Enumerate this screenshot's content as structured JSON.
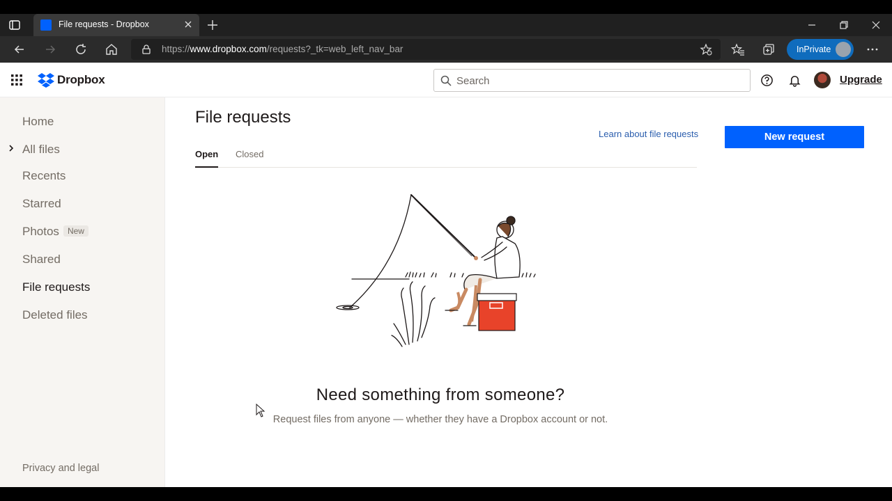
{
  "browser": {
    "tab_title": "File requests - Dropbox",
    "url_prefix": "https://",
    "url_host": "www.dropbox.com",
    "url_path": "/requests?_tk=web_left_nav_bar",
    "inprivate_label": "InPrivate"
  },
  "header": {
    "logo_text": "Dropbox",
    "search_placeholder": "Search",
    "upgrade_label": "Upgrade"
  },
  "sidebar": {
    "items": [
      {
        "label": "Home"
      },
      {
        "label": "All files"
      },
      {
        "label": "Recents"
      },
      {
        "label": "Starred"
      },
      {
        "label": "Photos",
        "badge": "New"
      },
      {
        "label": "Shared"
      },
      {
        "label": "File requests"
      },
      {
        "label": "Deleted files"
      }
    ],
    "footer": "Privacy and legal"
  },
  "main": {
    "title": "File requests",
    "learn_link": "Learn about file requests",
    "new_request_label": "New request",
    "tabs": [
      {
        "label": "Open"
      },
      {
        "label": "Closed"
      }
    ],
    "empty_title": "Need something from someone?",
    "empty_subtitle": "Request files from anyone — whether they have a Dropbox account or not."
  },
  "colors": {
    "brand": "#0061fe",
    "cooler": "#e8432a",
    "sidebar_bg": "#f7f5f2"
  }
}
